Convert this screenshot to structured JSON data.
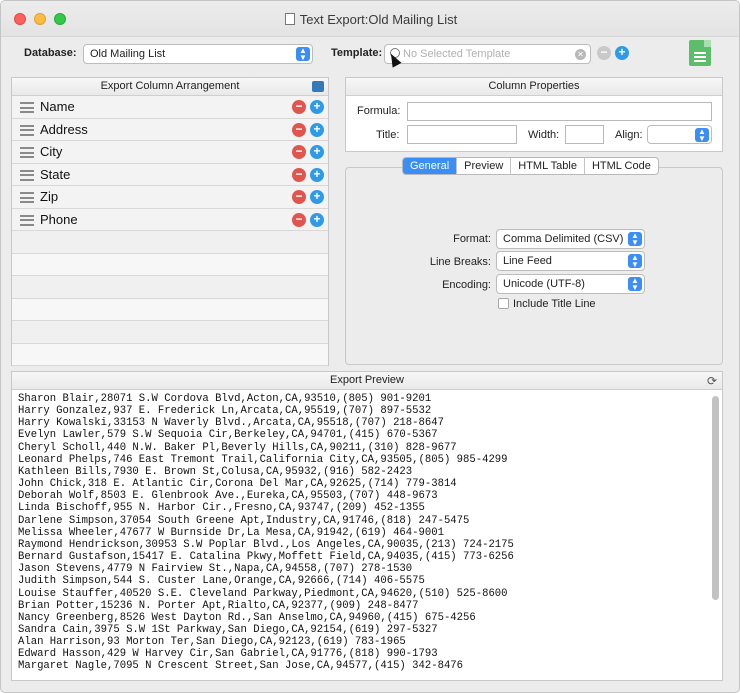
{
  "window": {
    "title": "Text Export:Old Mailing List",
    "title_icon": "document-icon"
  },
  "toolbar": {
    "database_label": "Database:",
    "database_value": "Old Mailing List",
    "template_label": "Template:",
    "template_placeholder": "No Selected Template",
    "export_icon": "spreadsheet-document-icon"
  },
  "columns_panel": {
    "header": "Export Column Arrangement",
    "items": [
      {
        "label": "Name"
      },
      {
        "label": "Address"
      },
      {
        "label": "City"
      },
      {
        "label": "State"
      },
      {
        "label": "Zip"
      },
      {
        "label": "Phone"
      }
    ]
  },
  "properties_panel": {
    "header": "Column Properties",
    "formula_label": "Formula:",
    "formula_value": "",
    "title_label": "Title:",
    "title_value": "",
    "width_label": "Width:",
    "width_value": "",
    "align_label": "Align:",
    "align_value": ""
  },
  "tabs": [
    {
      "label": "General",
      "active": true
    },
    {
      "label": "Preview",
      "active": false
    },
    {
      "label": "HTML Table",
      "active": false
    },
    {
      "label": "HTML Code",
      "active": false
    }
  ],
  "general": {
    "format_label": "Format:",
    "format_value": "Comma Delimited (CSV)",
    "line_breaks_label": "Line Breaks:",
    "line_breaks_value": "Line Feed",
    "encoding_label": "Encoding:",
    "encoding_value": "Unicode (UTF-8)",
    "include_title_label": "Include Title Line",
    "include_title_checked": false
  },
  "preview": {
    "header": "Export Preview",
    "lines": [
      "Sharon Blair,28071 S.W Cordova Blvd,Acton,CA,93510,(805) 901-9201",
      "Harry Gonzalez,937 E. Frederick Ln,Arcata,CA,95519,(707) 897-5532",
      "Harry Kowalski,33153 N Waverly Blvd.,Arcata,CA,95518,(707) 218-8647",
      "Evelyn Lawler,579 S.W Sequoia Cir,Berkeley,CA,94701,(415) 670-5367",
      "Cheryl Scholl,440 N.W. Baker Pl,Beverly Hills,CA,90211,(310) 828-9677",
      "Leonard Phelps,746 East Tremont Trail,California City,CA,93505,(805) 985-4299",
      "Kathleen Bills,7930 E. Brown St,Colusa,CA,95932,(916) 582-2423",
      "John Chick,318 E. Atlantic Cir,Corona Del Mar,CA,92625,(714) 779-3814",
      "Deborah Wolf,8503 E. Glenbrook Ave.,Eureka,CA,95503,(707) 448-9673",
      "Linda Bischoff,955 N. Harbor Cir.,Fresno,CA,93747,(209) 452-1355",
      "Darlene Simpson,37054 South Greene Apt,Industry,CA,91746,(818) 247-5475",
      "Melissa Wheeler,47677 W Burnside Dr,La Mesa,CA,91942,(619) 464-9001",
      "Raymond Hendrickson,30953 S.W Poplar Blvd.,Los Angeles,CA,90035,(213) 724-2175",
      "Bernard Gustafson,15417 E. Catalina Pkwy,Moffett Field,CA,94035,(415) 773-6256",
      "Jason Stevens,4779 N Fairview St.,Napa,CA,94558,(707) 278-1530",
      "Judith Simpson,544 S. Custer Lane,Orange,CA,92666,(714) 406-5575",
      "Louise Stauffer,40520 S.E. Cleveland Parkway,Piedmont,CA,94620,(510) 525-8600",
      "Brian Potter,15236 N. Porter Apt,Rialto,CA,92377,(909) 248-8477",
      "Nancy Greenberg,8526 West Dayton Rd.,San Anselmo,CA,94960,(415) 675-4256",
      "Sandra Cain,3975 S.W 1St Parkway,San Diego,CA,92154,(619) 297-5327",
      "Alan Harrison,93 Morton Ter,San Diego,CA,92123,(619) 783-1965",
      "Edward Hasson,429 W Harvey Cir,San Gabriel,CA,91776,(818) 990-1793",
      "Margaret Nagle,7095 N Crescent Street,San Jose,CA,94577,(415) 342-8476"
    ]
  }
}
